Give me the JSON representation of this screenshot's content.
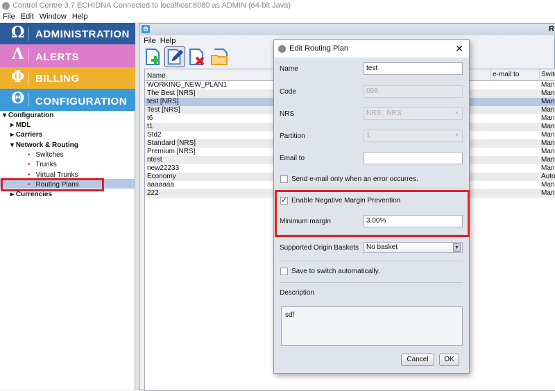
{
  "window": {
    "title": "Control Centre 3.7 ECHIDNA Connected to localhost:8080 as ADMIN (64-bit Java)"
  },
  "menubar": [
    "File",
    "Edit",
    "Window",
    "Help"
  ],
  "modules": [
    {
      "glyph": "Ω",
      "label": "ADMINISTRATION",
      "color": "#2b5d9e"
    },
    {
      "glyph": "Λ",
      "label": "ALERTS",
      "color": "#dd7cc8"
    },
    {
      "glyph": "Φ",
      "label": "BILLING",
      "color": "#efb02c"
    },
    {
      "glyph": "Θ",
      "label": "CONFIGURATION",
      "color": "#3c9ad8"
    }
  ],
  "tree": {
    "root": "Configuration",
    "mdl": "MDL",
    "carriers": "Carriers",
    "network": "Network & Routing",
    "switches": "Switches",
    "trunks": "Trunks",
    "virtual_trunks": "Virtual Trunks",
    "routing_plans": "Routing Plans",
    "currencies": "Currencies"
  },
  "frame": {
    "title": "R",
    "menu": [
      "File",
      "Help"
    ],
    "toolbar": [
      "add-icon",
      "edit-icon",
      "delete-icon",
      "folder-icon"
    ]
  },
  "table": {
    "columns": [
      "Name",
      "e-mail to",
      "Switc"
    ],
    "rows": [
      {
        "name": "WORKING_NEW_PLAN1",
        "switch": "Manu"
      },
      {
        "name": "The Best [NRS]",
        "switch": "Manu"
      },
      {
        "name": "test [NRS]",
        "switch": "Manu",
        "selected": true
      },
      {
        "name": "Test [NRS]",
        "switch": "Manu"
      },
      {
        "name": "t6",
        "switch": "Manu"
      },
      {
        "name": "t1",
        "switch": "Manu"
      },
      {
        "name": "Std2",
        "switch": "Manu"
      },
      {
        "name": "Standard [NRS]",
        "switch": "Manu"
      },
      {
        "name": "Premium [NRS]",
        "switch": "Manu"
      },
      {
        "name": "ntest",
        "switch": "Manu"
      },
      {
        "name": "new22233",
        "switch": "Manu"
      },
      {
        "name": "Economy",
        "switch": "Autor"
      },
      {
        "name": "aaaaaaa",
        "switch": "Manu"
      },
      {
        "name": "222",
        "switch": "Manu"
      }
    ]
  },
  "dialog": {
    "title": "Edit Routing Plan",
    "name_label": "Name",
    "name_value": "test",
    "code_label": "Code",
    "code_value": "098",
    "nrs_label": "NRS",
    "nrs_value": "NRS : NRS",
    "partition_label": "Partition",
    "partition_value": "1",
    "email_label": "Email to",
    "email_value": "",
    "send_error_label": "Send e-mail only when an error occurres.",
    "send_error_checked": false,
    "nmp_label": "Enable Negative Margin Prevention",
    "nmp_checked": true,
    "min_margin_label": "Minimum margin",
    "min_margin_value": "3.00%",
    "baskets_label": "Supported Origin Baskets",
    "baskets_value": "No basket",
    "save_switch_label": "Save to switch automatically.",
    "save_switch_checked": false,
    "description_label": "Description",
    "description_value": "sdf",
    "cancel": "Cancel",
    "ok": "OK"
  },
  "highlight_color": "#e0202a"
}
